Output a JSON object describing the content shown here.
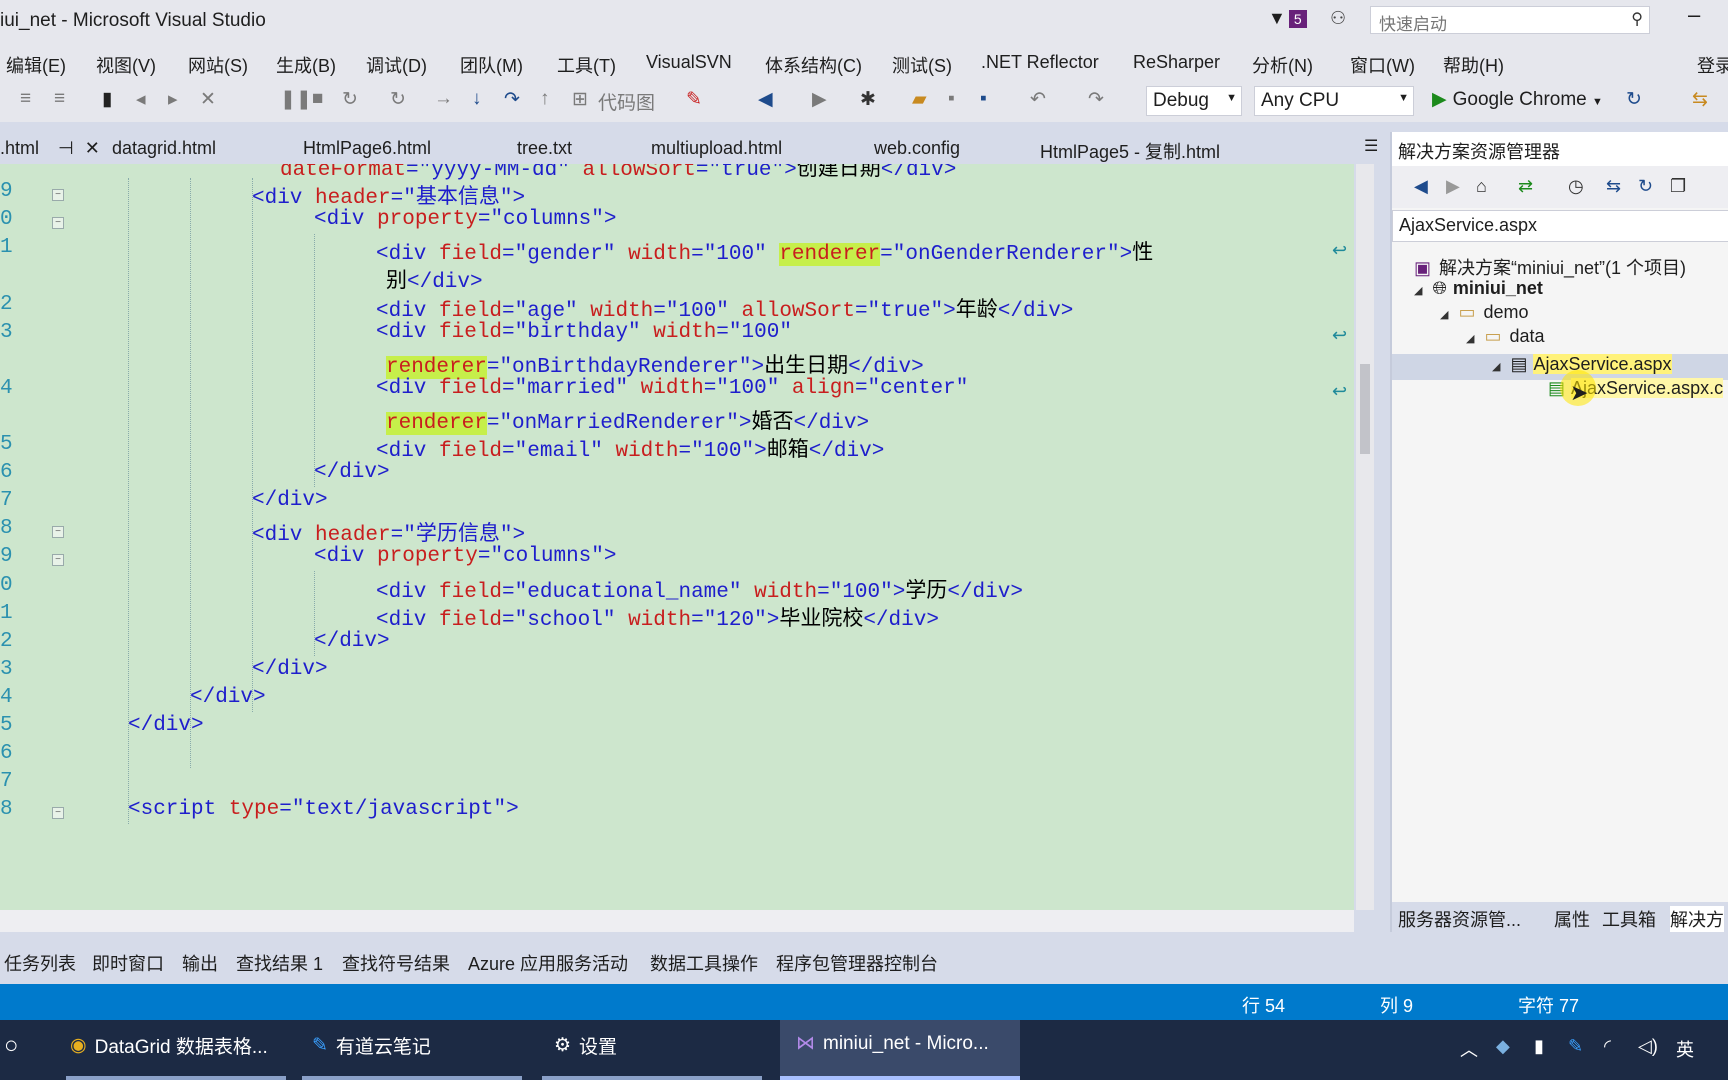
{
  "window": {
    "title": "iui_net - Microsoft Visual Studio",
    "notification_count": "5",
    "quick_launch_placeholder": "快速启动"
  },
  "menu": [
    "编辑(E)",
    "视图(V)",
    "网站(S)",
    "生成(B)",
    "调试(D)",
    "团队(M)",
    "工具(T)",
    "VisualSVN",
    "体系结构(C)",
    "测试(S)",
    ".NET Reflector",
    "ReSharper",
    "分析(N)",
    "窗口(W)",
    "帮助(H)",
    "登录"
  ],
  "toolbar": {
    "code_map_label": "代码图",
    "config": "Debug",
    "platform": "Any CPU",
    "run_target": "Google Chrome"
  },
  "tabs": [
    ".html",
    "datagrid.html",
    "HtmlPage6.html",
    "tree.txt",
    "multiupload.html",
    "web.config",
    "HtmlPage5 - 复制.html"
  ],
  "editor": {
    "line_numbers": [
      "9",
      "0",
      "1",
      "",
      "2",
      "3",
      "",
      "4",
      "",
      "5",
      "6",
      "7",
      "8",
      "9",
      "0",
      "1",
      "2",
      "3",
      "4",
      "5",
      "6",
      "7",
      "8"
    ],
    "lines": [
      {
        "indent": "",
        "parts": [
          [
            "attr",
            "dateFormat"
          ],
          [
            "tag",
            "="
          ],
          [
            "val",
            "\"yyyy-MM-dd\""
          ],
          [
            "tag",
            " "
          ],
          [
            "attr",
            "allowSort"
          ],
          [
            "tag",
            "="
          ],
          [
            "val",
            "\"true\""
          ],
          [
            "tag",
            ">"
          ],
          [
            "cn",
            "创建日期"
          ],
          [
            "tag",
            "</div>"
          ]
        ]
      },
      {
        "parts": [
          [
            "tag",
            "<div "
          ],
          [
            "attr",
            "header"
          ],
          [
            "tag",
            "="
          ],
          [
            "val",
            "\""
          ],
          [
            "cnb",
            "基本信息"
          ],
          [
            "val",
            "\""
          ],
          [
            "tag",
            ">"
          ]
        ]
      },
      {
        "parts": [
          [
            "tag",
            "<div "
          ],
          [
            "attr",
            "property"
          ],
          [
            "tag",
            "="
          ],
          [
            "val",
            "\"columns\""
          ],
          [
            "tag",
            ">"
          ]
        ]
      },
      {
        "parts": [
          [
            "tag",
            "<div "
          ],
          [
            "attr",
            "field"
          ],
          [
            "tag",
            "="
          ],
          [
            "val",
            "\"gender\""
          ],
          [
            "tag",
            " "
          ],
          [
            "attr",
            "width"
          ],
          [
            "tag",
            "="
          ],
          [
            "val",
            "\"100\""
          ],
          [
            "tag",
            " "
          ],
          [
            "hl",
            "renderer"
          ],
          [
            "tag",
            "="
          ],
          [
            "val",
            "\"onGenderRenderer\""
          ],
          [
            "tag",
            ">"
          ],
          [
            "cn",
            "性"
          ]
        ]
      },
      {
        "parts": [
          [
            "cn",
            "别"
          ],
          [
            "tag",
            "</div>"
          ]
        ]
      },
      {
        "parts": [
          [
            "tag",
            "<div "
          ],
          [
            "attr",
            "field"
          ],
          [
            "tag",
            "="
          ],
          [
            "val",
            "\"age\""
          ],
          [
            "tag",
            " "
          ],
          [
            "attr",
            "width"
          ],
          [
            "tag",
            "="
          ],
          [
            "val",
            "\"100\""
          ],
          [
            "tag",
            " "
          ],
          [
            "attr",
            "allowSort"
          ],
          [
            "tag",
            "="
          ],
          [
            "val",
            "\"true\""
          ],
          [
            "tag",
            ">"
          ],
          [
            "cn",
            "年龄"
          ],
          [
            "tag",
            "</div>"
          ]
        ]
      },
      {
        "parts": [
          [
            "tag",
            "<div "
          ],
          [
            "attr",
            "field"
          ],
          [
            "tag",
            "="
          ],
          [
            "val",
            "\"birthday\""
          ],
          [
            "tag",
            " "
          ],
          [
            "attr",
            "width"
          ],
          [
            "tag",
            "="
          ],
          [
            "val",
            "\"100\""
          ]
        ]
      },
      {
        "parts": [
          [
            "hl",
            "renderer"
          ],
          [
            "tag",
            "="
          ],
          [
            "val",
            "\"onBirthdayRenderer\""
          ],
          [
            "tag",
            ">"
          ],
          [
            "cn",
            "出生日期"
          ],
          [
            "tag",
            "</div>"
          ]
        ]
      },
      {
        "parts": [
          [
            "tag",
            "<div "
          ],
          [
            "attr",
            "field"
          ],
          [
            "tag",
            "="
          ],
          [
            "val",
            "\"married\""
          ],
          [
            "tag",
            " "
          ],
          [
            "attr",
            "width"
          ],
          [
            "tag",
            "="
          ],
          [
            "val",
            "\"100\""
          ],
          [
            "tag",
            " "
          ],
          [
            "attr",
            "align"
          ],
          [
            "tag",
            "="
          ],
          [
            "val",
            "\"center\""
          ]
        ]
      },
      {
        "parts": [
          [
            "hl",
            "renderer"
          ],
          [
            "tag",
            "="
          ],
          [
            "val",
            "\"onMarriedRenderer\""
          ],
          [
            "tag",
            ">"
          ],
          [
            "cn",
            "婚否"
          ],
          [
            "tag",
            "</div>"
          ]
        ]
      },
      {
        "parts": [
          [
            "tag",
            "<div "
          ],
          [
            "attr",
            "field"
          ],
          [
            "tag",
            "="
          ],
          [
            "val",
            "\"email\""
          ],
          [
            "tag",
            " "
          ],
          [
            "attr",
            "width"
          ],
          [
            "tag",
            "="
          ],
          [
            "val",
            "\"100\""
          ],
          [
            "tag",
            ">"
          ],
          [
            "cn",
            "邮箱"
          ],
          [
            "tag",
            "</div>"
          ]
        ]
      },
      {
        "parts": [
          [
            "tag",
            "</div>"
          ]
        ]
      },
      {
        "parts": [
          [
            "tag",
            "</div>"
          ]
        ]
      },
      {
        "parts": [
          [
            "tag",
            "<div "
          ],
          [
            "attr",
            "header"
          ],
          [
            "tag",
            "="
          ],
          [
            "val",
            "\""
          ],
          [
            "cnb",
            "学历信息"
          ],
          [
            "val",
            "\""
          ],
          [
            "tag",
            ">"
          ]
        ]
      },
      {
        "parts": [
          [
            "tag",
            "<div "
          ],
          [
            "attr",
            "property"
          ],
          [
            "tag",
            "="
          ],
          [
            "val",
            "\"columns\""
          ],
          [
            "tag",
            ">"
          ]
        ]
      },
      {
        "parts": [
          [
            "tag",
            "<div "
          ],
          [
            "attr",
            "field"
          ],
          [
            "tag",
            "="
          ],
          [
            "val",
            "\"educational_name\""
          ],
          [
            "tag",
            " "
          ],
          [
            "attr",
            "width"
          ],
          [
            "tag",
            "="
          ],
          [
            "val",
            "\"100\""
          ],
          [
            "tag",
            ">"
          ],
          [
            "cn",
            "学历"
          ],
          [
            "tag",
            "</div>"
          ]
        ]
      },
      {
        "parts": [
          [
            "tag",
            "<div "
          ],
          [
            "attr",
            "field"
          ],
          [
            "tag",
            "="
          ],
          [
            "val",
            "\"school\""
          ],
          [
            "tag",
            " "
          ],
          [
            "attr",
            "width"
          ],
          [
            "tag",
            "="
          ],
          [
            "val",
            "\"120\""
          ],
          [
            "tag",
            ">"
          ],
          [
            "cn",
            "毕业院校"
          ],
          [
            "tag",
            "</div>"
          ]
        ]
      },
      {
        "parts": [
          [
            "tag",
            "</div>"
          ]
        ]
      },
      {
        "parts": [
          [
            "tag",
            "</div>"
          ]
        ]
      },
      {
        "parts": [
          [
            "tag",
            "</div>"
          ]
        ]
      },
      {
        "parts": [
          [
            "tag",
            "</div>"
          ]
        ]
      },
      {
        "parts": []
      },
      {
        "parts": []
      },
      {
        "parts": [
          [
            "tag",
            "<script "
          ],
          [
            "attr",
            "type"
          ],
          [
            "tag",
            "="
          ],
          [
            "val",
            "\"text/javascript\""
          ],
          [
            "tag",
            ">"
          ]
        ]
      }
    ]
  },
  "solution_explorer": {
    "title": "解决方案资源管理器",
    "search_value": "AjaxService.aspx",
    "tree": [
      "解决方案“miniui_net”(1 个项目)",
      "miniui_net",
      "demo",
      "data",
      "AjaxService.aspx",
      "AjaxService.aspx.c"
    ],
    "bottom_tabs": [
      "服务器资源管...",
      "属性",
      "工具箱",
      "解决方"
    ]
  },
  "panel_tabs": [
    "任务列表",
    "即时窗口",
    "输出",
    "查找结果 1",
    "查找符号结果",
    "Azure 应用服务活动",
    "数据工具操作",
    "程序包管理器控制台"
  ],
  "status": {
    "line": "行 54",
    "col": "列 9",
    "char": "字符 77"
  },
  "taskbar": {
    "items": [
      "DataGrid 数据表格...",
      "有道云笔记",
      "设置",
      "miniui_net - Micro..."
    ],
    "ime": "英"
  }
}
